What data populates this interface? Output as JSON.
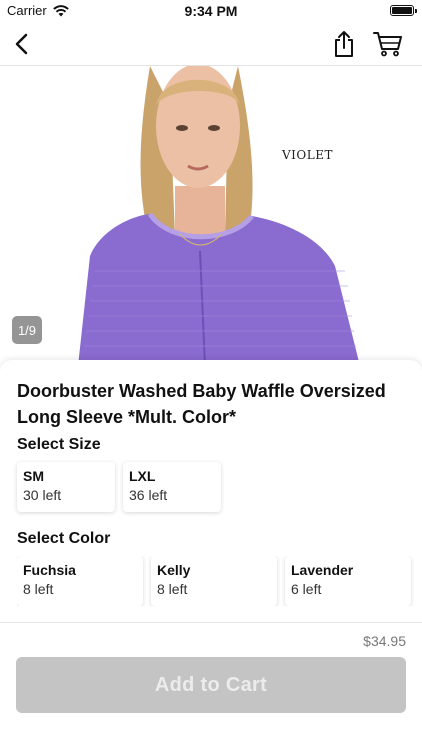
{
  "status_bar": {
    "carrier": "Carrier",
    "time": "9:34 PM"
  },
  "nav": {
    "back_icon": "chevron-left-icon",
    "share_icon": "share-icon",
    "cart_icon": "cart-icon"
  },
  "hero": {
    "image_text": "VIOLET",
    "counter": "1/9",
    "sweater_color": "#8a6bd0"
  },
  "product": {
    "title": "Doorbuster Washed Baby Waffle Oversized Long Sleeve *Mult. Color*",
    "size_label": "Select Size",
    "sizes": [
      {
        "name": "SM",
        "stock": "30 left"
      },
      {
        "name": "LXL",
        "stock": "36 left"
      }
    ],
    "color_label": "Select Color",
    "colors": [
      {
        "name": "Fuchsia",
        "stock": "8 left"
      },
      {
        "name": "Kelly",
        "stock": "8 left"
      },
      {
        "name": "Lavender",
        "stock": "6 left"
      }
    ]
  },
  "footer": {
    "price": "$34.95",
    "add_button": "Add to Cart",
    "button_color": "#c4c4c4"
  }
}
